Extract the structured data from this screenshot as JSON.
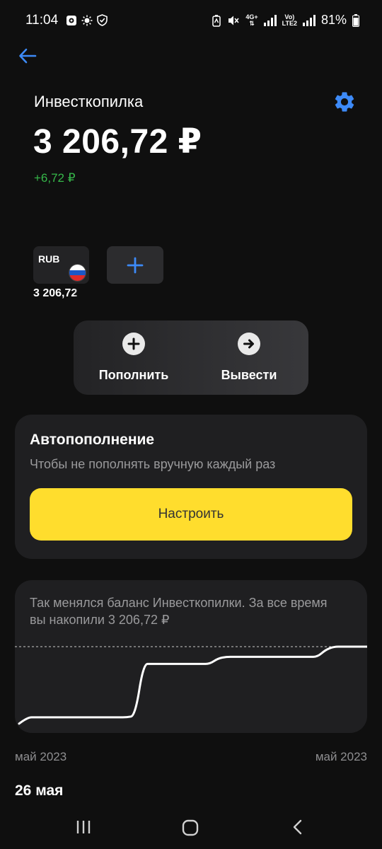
{
  "status_bar": {
    "time": "11:04",
    "network_4g": "4G+",
    "volte_line1": "Vo)",
    "volte_line2": "LTE2",
    "battery": "81%"
  },
  "header": {
    "back_icon": "arrow-left-icon",
    "settings_icon": "gear-icon"
  },
  "account": {
    "title": "Инвесткопилка",
    "balance": "3 206,72 ₽",
    "delta": "+6,72 ₽"
  },
  "currencies": [
    {
      "code": "RUB",
      "amount": "3 206,72"
    }
  ],
  "actions": {
    "top_up": "Пополнить",
    "withdraw": "Вывести"
  },
  "autofill": {
    "title": "Автопополнение",
    "subtitle": "Чтобы не пополнять вручную каждый раз",
    "button": "Настроить"
  },
  "chart_data": {
    "type": "line",
    "text": "Так менялся баланс Инвесткопилки. За все время вы накопили 3 206,72 ₽",
    "x_labels": [
      "май 2023",
      "май 2023"
    ],
    "series": [
      {
        "values": [
          0.02,
          0.1,
          0.1,
          0.1,
          0.1,
          0.1,
          0.1,
          0.1,
          0.1,
          0.1,
          0.1,
          0.1,
          0.1,
          0.1,
          0.12,
          0.78,
          0.78,
          0.78,
          0.78,
          0.78,
          0.78,
          0.78,
          0.78,
          0.78,
          0.85,
          0.87,
          0.87,
          0.87,
          0.87,
          0.87,
          0.87,
          0.87,
          0.87,
          0.87,
          0.87,
          0.87,
          0.87,
          0.96,
          1.0,
          1.0,
          1.0,
          1.0,
          1.0
        ]
      }
    ],
    "reference_line": 1.0,
    "colors": {
      "line": "#ffffff",
      "reference": "#cccccc"
    }
  },
  "history": {
    "date_heading": "26 мая"
  },
  "colors": {
    "background": "#0f0f0f",
    "accent_blue": "#3d8af7",
    "positive_green": "#36b84a",
    "button_yellow": "#ffdd2d",
    "card": "#1f1f21"
  }
}
